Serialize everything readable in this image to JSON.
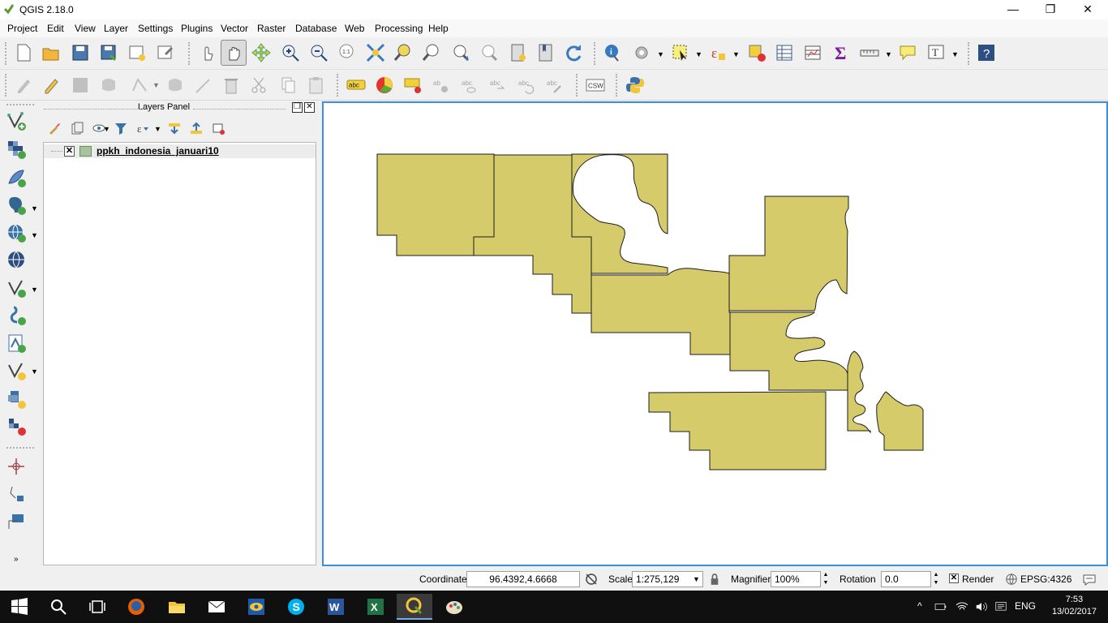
{
  "window": {
    "title": "QGIS 2.18.0",
    "minimize": "—",
    "maximize": "❐",
    "close": "✕"
  },
  "menu": [
    "Project",
    "Edit",
    "View",
    "Layer",
    "Settings",
    "Plugins",
    "Vector",
    "Raster",
    "Database",
    "Web",
    "Processing",
    "Help"
  ],
  "toolbar2": {
    "csw_label": "CSW",
    "label_abc": "abc"
  },
  "layers_panel": {
    "title": "Layers Panel",
    "layers": [
      {
        "name": "ppkh_indonesia_januari10",
        "visible": true,
        "fill": "#a9c49a"
      }
    ]
  },
  "map": {
    "feature_fill": "#d5cb6a",
    "feature_stroke": "#1e1e1e"
  },
  "status": {
    "coordinate_label": "Coordinate",
    "coordinate_value": "96.4392,4.6668",
    "scale_label": "Scale",
    "scale_value": "1:275,129",
    "magnifier_label": "Magnifier",
    "magnifier_value": "100%",
    "rotation_label": "Rotation",
    "rotation_value": "0.0",
    "render_label": "Render",
    "crs": "EPSG:4326"
  },
  "taskbar": {
    "lang": "ENG",
    "time": "7:53",
    "date": "13/02/2017"
  }
}
